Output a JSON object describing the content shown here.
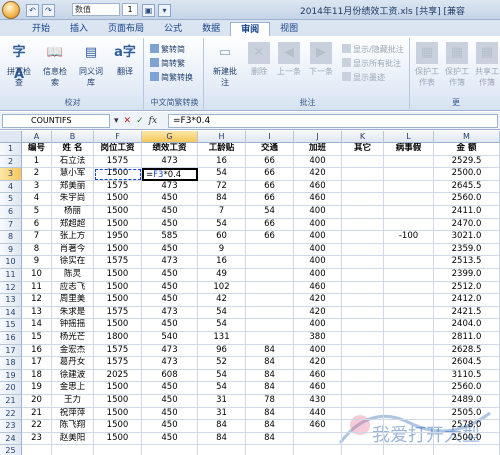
{
  "window": {
    "title": "2014年11月份绩效工资.xls [共享] [兼容"
  },
  "quick_access": {
    "font_name": "数值",
    "font_size": "1"
  },
  "tabs": [
    "开始",
    "插入",
    "页面布局",
    "公式",
    "数据",
    "审阅",
    "视图"
  ],
  "active_tab": "审阅",
  "ribbon": {
    "proofing": {
      "label": "校对",
      "buttons": [
        "拼写检查",
        "信息检索",
        "同义词库",
        "翻译"
      ]
    },
    "chinese": {
      "label": "中文简繁转换",
      "buttons": [
        "繁转简",
        "简转繁",
        "简繁转换"
      ]
    },
    "comments": {
      "label": "批注",
      "buttons": [
        "新建批注",
        "删除",
        "上一条",
        "下一条"
      ],
      "small": [
        "显示/隐藏批注",
        "显示所有批注",
        "显示墨迹"
      ]
    },
    "changes": {
      "label": "更",
      "buttons": [
        "保护工作表",
        "保护工作簿",
        "共享工作簿"
      ]
    }
  },
  "formula_bar": {
    "name_box": "COUNTIFS",
    "content": "=F3*0.4"
  },
  "columns": [
    "A",
    "B",
    "F",
    "G",
    "H",
    "I",
    "J",
    "K",
    "L",
    "M"
  ],
  "header_row": [
    "编号",
    "姓 名",
    "岗位工资",
    "绩效工资",
    "工龄贴",
    "交通",
    "加班",
    "其它",
    "病事假",
    "金 额"
  ],
  "rows": [
    [
      "1",
      "石立法",
      "1575",
      "473",
      "16",
      "66",
      "400",
      "",
      "",
      "2529.5"
    ],
    [
      "2",
      "慧小军",
      "1500",
      "=F3*0.4",
      "54",
      "66",
      "420",
      "",
      "",
      "2500.0"
    ],
    [
      "3",
      "郑美丽",
      "1575",
      "473",
      "72",
      "66",
      "460",
      "",
      "",
      "2645.5"
    ],
    [
      "4",
      "朱宇尚",
      "1500",
      "450",
      "84",
      "66",
      "460",
      "",
      "",
      "2560.0"
    ],
    [
      "5",
      "杨丽",
      "1500",
      "450",
      "7",
      "54",
      "400",
      "",
      "",
      "2411.0"
    ],
    [
      "6",
      "郑超超",
      "1500",
      "450",
      "54",
      "66",
      "400",
      "",
      "",
      "2470.0"
    ],
    [
      "7",
      "张上方",
      "1950",
      "585",
      "60",
      "66",
      "400",
      "",
      "-100",
      "3021.0"
    ],
    [
      "8",
      "肖著今",
      "1500",
      "450",
      "9",
      "",
      "400",
      "",
      "",
      "2359.0"
    ],
    [
      "9",
      "徐实在",
      "1575",
      "473",
      "16",
      "",
      "400",
      "",
      "",
      "2513.5"
    ],
    [
      "10",
      "陈灵",
      "1500",
      "450",
      "49",
      "",
      "400",
      "",
      "",
      "2399.0"
    ],
    [
      "11",
      "应志飞",
      "1500",
      "450",
      "102",
      "",
      "460",
      "",
      "",
      "2512.0"
    ],
    [
      "12",
      "周里美",
      "1500",
      "450",
      "42",
      "",
      "420",
      "",
      "",
      "2412.0"
    ],
    [
      "13",
      "朱求是",
      "1575",
      "473",
      "54",
      "",
      "420",
      "",
      "",
      "2421.5"
    ],
    [
      "14",
      "钟摇摇",
      "1500",
      "450",
      "54",
      "",
      "400",
      "",
      "",
      "2404.0"
    ],
    [
      "15",
      "杨光芒",
      "1800",
      "540",
      "131",
      "",
      "380",
      "",
      "",
      "2811.0"
    ],
    [
      "16",
      "金宏杰",
      "1575",
      "473",
      "96",
      "84",
      "400",
      "",
      "",
      "2628.5"
    ],
    [
      "17",
      "葛丹女",
      "1575",
      "473",
      "52",
      "84",
      "420",
      "",
      "",
      "2604.5"
    ],
    [
      "18",
      "徐建波",
      "2025",
      "608",
      "54",
      "84",
      "460",
      "",
      "",
      "3110.5"
    ],
    [
      "19",
      "金思上",
      "1500",
      "450",
      "54",
      "84",
      "460",
      "",
      "",
      "2560.0"
    ],
    [
      "20",
      "王力",
      "1500",
      "450",
      "31",
      "78",
      "430",
      "",
      "",
      "2489.0"
    ],
    [
      "21",
      "祝萍萍",
      "1500",
      "450",
      "31",
      "84",
      "440",
      "",
      "",
      "2505.0"
    ],
    [
      "22",
      "陈飞翔",
      "1500",
      "450",
      "84",
      "84",
      "460",
      "",
      "",
      "2578.0"
    ],
    [
      "23",
      "赵美阳",
      "1500",
      "450",
      "84",
      "84",
      "",
      "",
      "",
      "2500.0"
    ]
  ],
  "row_numbers": [
    "1",
    "2",
    "3",
    "4",
    "5",
    "6",
    "7",
    "8",
    "9",
    "10",
    "11",
    "12",
    "13",
    "14",
    "15",
    "16",
    "17",
    "18",
    "19",
    "20",
    "21",
    "22",
    "23",
    "24",
    "25"
  ],
  "watermark_text": "我爱打开大型"
}
